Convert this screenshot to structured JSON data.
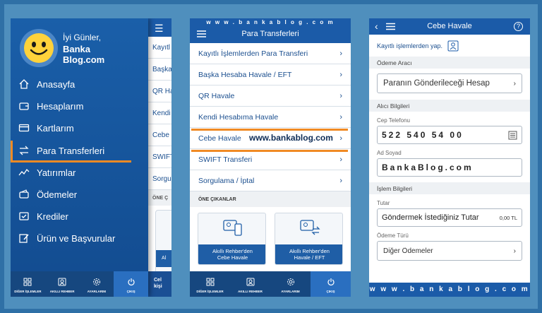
{
  "phone1": {
    "greeting": "İyi Günler,",
    "user_line1": "Banka",
    "user_line2": "Blog.com",
    "menu": [
      {
        "label": "Anasayfa",
        "icon": "home-icon"
      },
      {
        "label": "Hesaplarım",
        "icon": "wallet-icon"
      },
      {
        "label": "Kartlarım",
        "icon": "card-icon"
      },
      {
        "label": "Para Transferleri",
        "icon": "transfer-icon"
      },
      {
        "label": "Yatırımlar",
        "icon": "chart-icon"
      },
      {
        "label": "Ödemeler",
        "icon": "wallet-pay-icon"
      },
      {
        "label": "Krediler",
        "icon": "credit-icon"
      },
      {
        "label": "Ürün ve Başvurular",
        "icon": "edit-icon"
      }
    ],
    "back_rows": [
      "Kayıtl",
      "Başka",
      "QR Ha",
      "Kendi",
      "Cebe",
      "SWIFT",
      "Sorgul"
    ],
    "back_section": "ÖNE Ç",
    "back_card_btn": "Al",
    "back_bottom_line1": "Cel",
    "back_bottom_line2": "kişi"
  },
  "tabs": [
    {
      "label": "DİĞER İŞLEMLER",
      "icon": "grid-icon"
    },
    {
      "label": "AKILLI REHBER",
      "icon": "contact-book-icon"
    },
    {
      "label": "AYARLARIM",
      "icon": "gear-icon"
    },
    {
      "label": "ÇIKIŞ",
      "icon": "power-icon"
    }
  ],
  "phone2": {
    "url": "w w w . b a n k a b l o g . c o m",
    "title": "Para Transferleri",
    "rows": [
      "Kayıtlı İşlemlerden Para Transferi",
      "Başka Hesaba Havale / EFT",
      "QR Havale",
      "Kendi Hesabıma Havale",
      "Cebe Havale",
      "SWIFT Transferi",
      "Sorgulama / İptal"
    ],
    "watermark": "www.bankablog.com",
    "section": "ÖNE ÇIKANLAR",
    "card1_line1": "Akıllı Rehber'den",
    "card1_line2": "Cebe Havale",
    "card2_line1": "Akıllı Rehber'den",
    "card2_line2": "Havale / EFT"
  },
  "phone3": {
    "title": "Cebe Havale",
    "saved": "Kayıtlı işlemlerden yap.",
    "sec_payment": "Ödeme Aracı",
    "payment_select": "Paranın Gönderileceği Hesap",
    "sec_receiver": "Alıcı Bilgileri",
    "phone_label": "Cep Telefonu",
    "phone_value": "522 540 54 00",
    "name_label": "Ad Soyad",
    "name_value": "BankaBlog.com",
    "sec_transaction": "İşlem Bilgileri",
    "amount_label": "Tutar",
    "amount_value": "Göndermek İstediğiniz Tutar",
    "amount_currency": "0,00 TL",
    "pay_type_label": "Ödeme Türü",
    "pay_type_value": "Diğer Ödemeler",
    "url": "w w w . b a n k a b l o g . c o m"
  },
  "colors": {
    "primary": "#1b5ba8",
    "accent": "#f08a24",
    "background": "#4f8fbd"
  }
}
